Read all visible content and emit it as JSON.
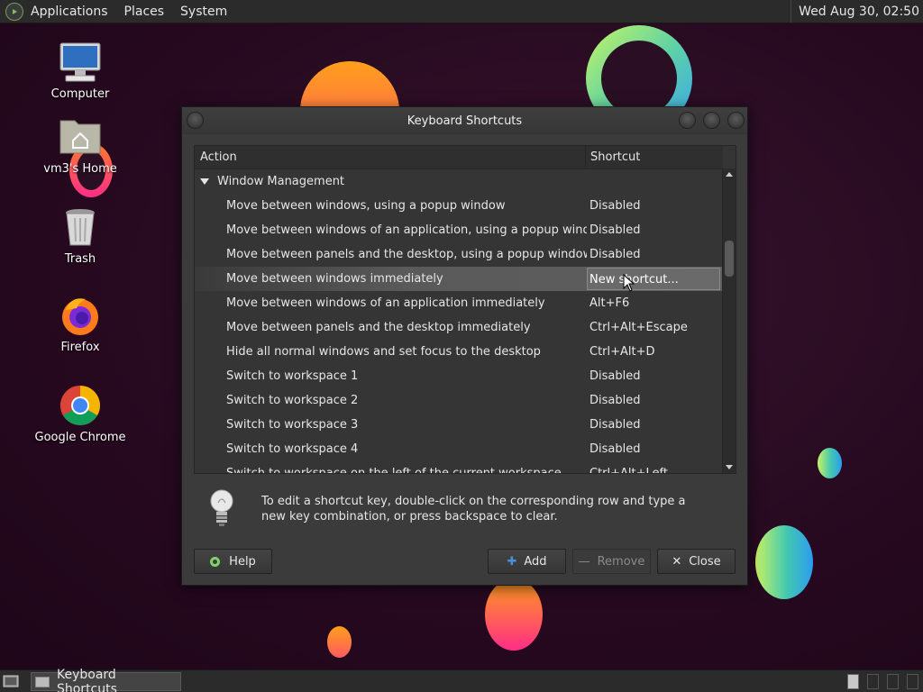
{
  "top_panel": {
    "menus": [
      "Applications",
      "Places",
      "System"
    ],
    "clock": "Wed Aug 30, 02:50"
  },
  "desktop_icons": {
    "computer": "Computer",
    "home": "vm3's Home",
    "trash": "Trash",
    "firefox": "Firefox",
    "chrome": "Google Chrome"
  },
  "dialog": {
    "title": "Keyboard Shortcuts",
    "columns": {
      "action": "Action",
      "shortcut": "Shortcut"
    },
    "group": "Window Management",
    "rows": [
      {
        "action": "Move between windows, using a popup window",
        "shortcut": "Disabled"
      },
      {
        "action": "Move between windows of an application, using a popup window",
        "shortcut": "Disabled"
      },
      {
        "action": "Move between panels and the desktop, using a popup window",
        "shortcut": "Disabled"
      },
      {
        "action": "Move between windows immediately",
        "shortcut": "New shortcut..."
      },
      {
        "action": "Move between windows of an application immediately",
        "shortcut": "Alt+F6"
      },
      {
        "action": "Move between panels and the desktop immediately",
        "shortcut": "Ctrl+Alt+Escape"
      },
      {
        "action": "Hide all normal windows and set focus to the desktop",
        "shortcut": "Ctrl+Alt+D"
      },
      {
        "action": "Switch to workspace 1",
        "shortcut": "Disabled"
      },
      {
        "action": "Switch to workspace 2",
        "shortcut": "Disabled"
      },
      {
        "action": "Switch to workspace 3",
        "shortcut": "Disabled"
      },
      {
        "action": "Switch to workspace 4",
        "shortcut": "Disabled"
      },
      {
        "action": "Switch to workspace on the left of the current workspace",
        "shortcut": "Ctrl+Alt+Left"
      }
    ],
    "hint": "To edit a shortcut key, double-click on the corresponding row and type a new key combination, or press backspace to clear.",
    "buttons": {
      "help": "Help",
      "add": "Add",
      "remove": "Remove",
      "close": "Close"
    }
  },
  "taskbar": {
    "task": "Keyboard Shortcuts"
  },
  "colors": {
    "panel": "#2b2b2b",
    "dialog_bg": "#3b3b3b",
    "selected_row": "#5e5e5e",
    "help_icon": "#7fd36a",
    "add_icon": "#4a90d9"
  }
}
